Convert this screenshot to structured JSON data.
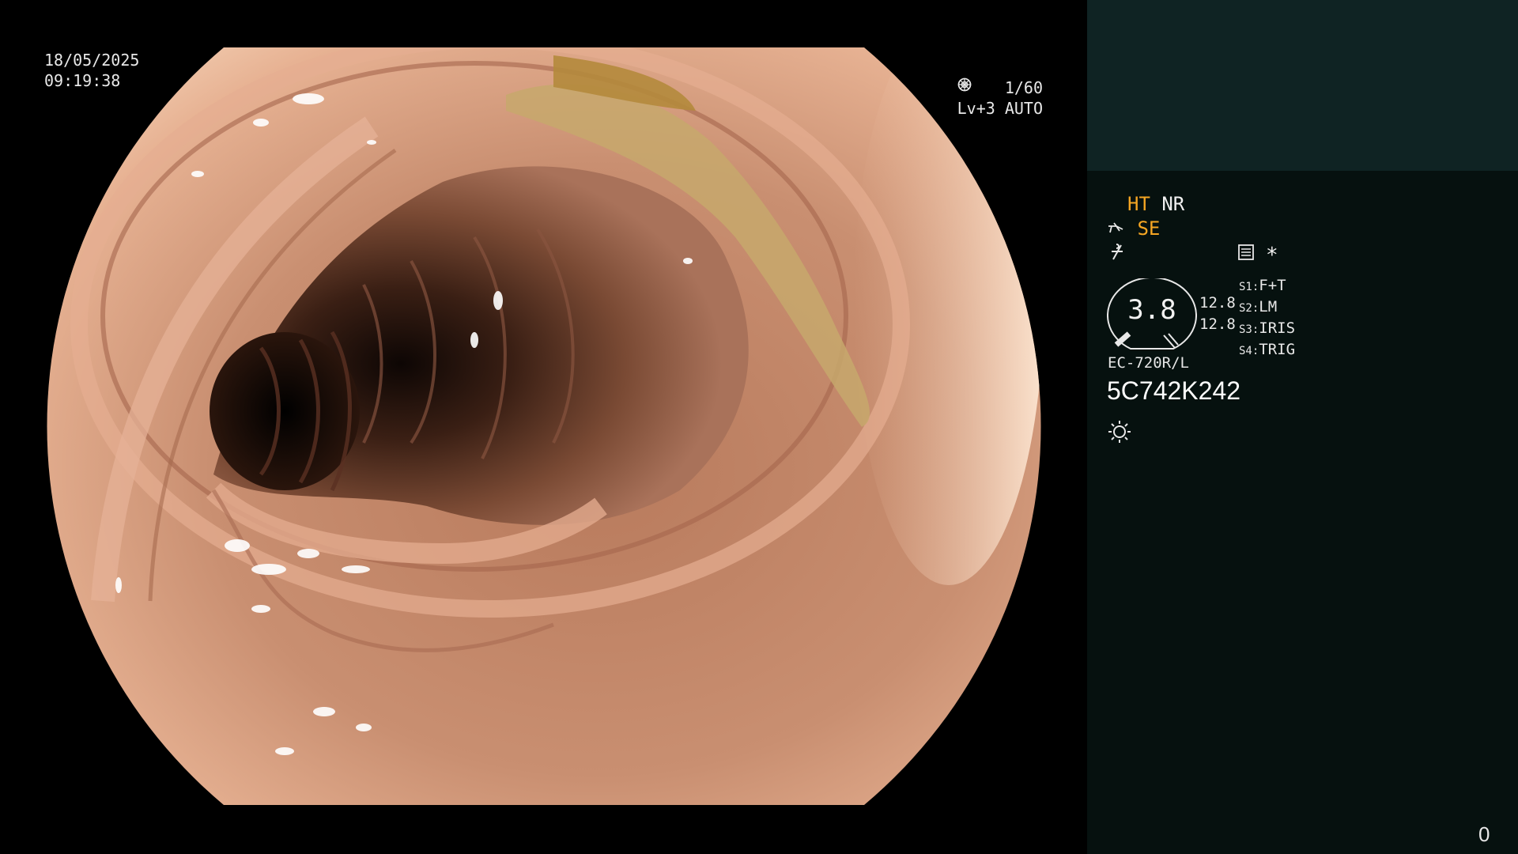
{
  "overlay": {
    "date": "18/05/2025",
    "time": "09:19:38",
    "shutter": "1/60",
    "shutter_icon": "aperture-icon",
    "level": "Lv+3 AUTO",
    "auto_icon": "target-icon"
  },
  "panel": {
    "mode_ht": "HT",
    "mode_nr": "NR",
    "mode_se": "SE",
    "se_icon": "pump-icon",
    "freeze_icon": "freeze-icon",
    "memo_icon": "memo-icon",
    "asterisk": "*",
    "gauge_value": "3.8",
    "side_values": [
      "12.8",
      "12.8"
    ],
    "switches": [
      {
        "key": "S1",
        "value": "F+T"
      },
      {
        "key": "S2",
        "value": "LM"
      },
      {
        "key": "S3",
        "value": "IRIS"
      },
      {
        "key": "S4",
        "value": "TRIG"
      }
    ],
    "model": "EC-720R/L",
    "serial": "5C742K242",
    "light_icon": "sun-icon",
    "counter": "0"
  },
  "colors": {
    "accent_orange": "#f5a623",
    "panel_bg": "#06110f",
    "panel_top_bg": "#0f2323"
  }
}
